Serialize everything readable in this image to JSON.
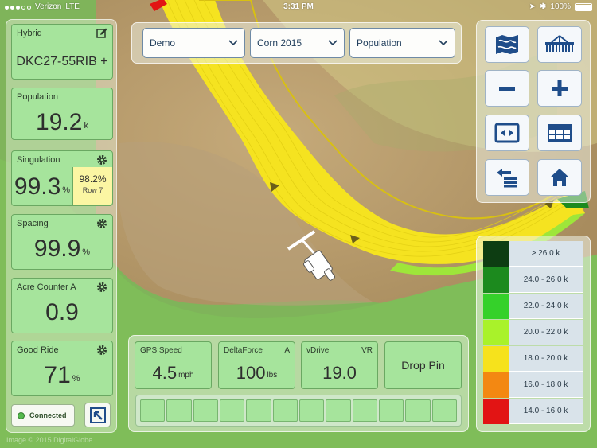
{
  "status_bar": {
    "carrier": "Verizon",
    "network": "LTE",
    "time": "3:31 PM",
    "battery": "100%",
    "battery_fraction": 1.0
  },
  "left_panel": {
    "hybrid": {
      "label": "Hybrid",
      "value": "DKC27-55RIB +",
      "icon": "edit-icon"
    },
    "population": {
      "label": "Population",
      "value": "19.2",
      "unit": "k"
    },
    "singulation": {
      "label": "Singulation",
      "value": "99.3",
      "unit": "%",
      "row_value": "98.2%",
      "row_label": "Row 7",
      "icon": "gear-icon"
    },
    "spacing": {
      "label": "Spacing",
      "value": "99.9",
      "unit": "%",
      "icon": "gear-icon"
    },
    "acre_counter": {
      "label": "Acre Counter A",
      "value": "0.9",
      "icon": "gear-icon"
    },
    "good_ride": {
      "label": "Good Ride",
      "value": "71",
      "unit": "%",
      "icon": "gear-icon"
    },
    "connected_label": "Connected",
    "expand_icon": "arrow-up-left-icon"
  },
  "selectors": {
    "farm": "Demo",
    "field": "Corn 2015",
    "layer": "Population"
  },
  "tools": {
    "map_icon": "map-view-icon",
    "planter_icon": "planter-icon",
    "zoom_out_icon": "minus-icon",
    "zoom_in_icon": "plus-icon",
    "fit_icon": "fit-view-icon",
    "table_icon": "table-icon",
    "swap_icon": "swap-icon",
    "home_icon": "home-icon"
  },
  "legend": [
    {
      "label": "> 26.0 k",
      "color": "#0d3d12"
    },
    {
      "label": "24.0 - 26.0 k",
      "color": "#1c8a1e"
    },
    {
      "label": "22.0 - 24.0 k",
      "color": "#35d12a"
    },
    {
      "label": "20.0 - 22.0 k",
      "color": "#a9f22a"
    },
    {
      "label": "18.0 - 20.0 k",
      "color": "#f6e21c"
    },
    {
      "label": "16.0 - 18.0 k",
      "color": "#f38812"
    },
    {
      "label": "14.0 - 16.0 k",
      "color": "#e21414"
    }
  ],
  "bottom_bar": {
    "gps_speed": {
      "label": "GPS Speed",
      "value": "4.5",
      "unit": "mph"
    },
    "delta_force": {
      "label": "DeltaForce",
      "flag": "A",
      "value": "100",
      "unit": "lbs"
    },
    "vdrive": {
      "label": "vDrive",
      "flag": "VR",
      "value": "19.0"
    },
    "drop_pin": "Drop Pin",
    "row_count": 12
  },
  "watermark": "Image © 2015 DigitalGlobe"
}
